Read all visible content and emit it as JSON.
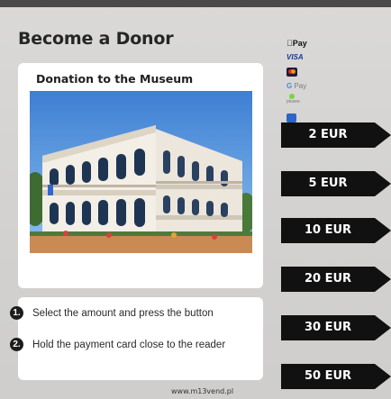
{
  "header": {
    "title": "Become a Donor"
  },
  "card": {
    "title": "Donation to the Museum"
  },
  "payment_methods": {
    "apple_pay": "Pay",
    "visa": "VISA",
    "google_pay_g": "G",
    "google_pay": "Pay",
    "pluxee": "pluxee"
  },
  "amounts": [
    "2 EUR",
    "5 EUR",
    "10 EUR",
    "20 EUR",
    "30 EUR",
    "50 EUR"
  ],
  "instructions": {
    "steps": [
      {
        "num": "1.",
        "text": "Select the amount and press the button"
      },
      {
        "num": "2.",
        "text": "Hold the payment card close to the reader"
      }
    ]
  },
  "footer": {
    "website": "www.m13vend.pl"
  },
  "colors": {
    "button": "#111111",
    "card": "#ffffff",
    "background": "#d6d5d3"
  }
}
